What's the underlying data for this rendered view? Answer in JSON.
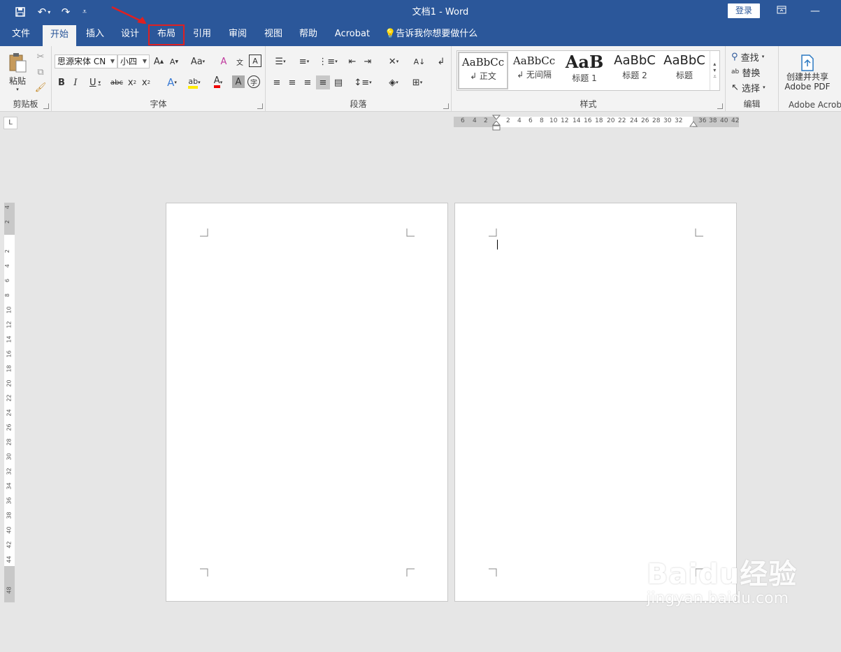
{
  "titlebar": {
    "title": "文档1  -  Word",
    "login_label": "登录",
    "quick_access": [
      "save-icon",
      "undo-icon",
      "redo-icon",
      "customize-icon"
    ]
  },
  "tabs": [
    {
      "label": "文件"
    },
    {
      "label": "开始"
    },
    {
      "label": "插入"
    },
    {
      "label": "设计"
    },
    {
      "label": "布局"
    },
    {
      "label": "引用"
    },
    {
      "label": "审阅"
    },
    {
      "label": "视图"
    },
    {
      "label": "帮助"
    },
    {
      "label": "Acrobat"
    }
  ],
  "tell_me": "告诉我你想要做什么",
  "clipboard": {
    "paste_label": "粘贴",
    "group_label": "剪贴板"
  },
  "font": {
    "font_name": "思源宋体 CN",
    "font_size": "小四",
    "group_label": "字体"
  },
  "paragraph": {
    "group_label": "段落"
  },
  "styles": {
    "group_label": "样式",
    "items": [
      {
        "preview": "AaBbCc",
        "name": "↲ 正文"
      },
      {
        "preview": "AaBbCc",
        "name": "↲ 无间隔"
      },
      {
        "preview": "AaB",
        "name": "标题 1"
      },
      {
        "preview": "AaBbC",
        "name": "标题 2"
      },
      {
        "preview": "AaBbC",
        "name": "标题"
      }
    ]
  },
  "editing": {
    "find": "查找",
    "replace": "替换",
    "select": "选择",
    "group_label": "编辑"
  },
  "acrobat": {
    "create_line1": "创建并共享",
    "create_line2": "Adobe PDF",
    "group_label": "Adobe Acrob"
  },
  "ruler": {
    "h_left": [
      "6",
      "4",
      "2"
    ],
    "h_main": [
      "2",
      "4",
      "6",
      "8",
      "10",
      "12",
      "14",
      "16",
      "18",
      "20",
      "22",
      "24",
      "26",
      "28",
      "30",
      "32"
    ],
    "h_right": [
      "36",
      "38",
      "40",
      "42"
    ],
    "v_top": [
      "4",
      "2"
    ],
    "v_main": [
      "2",
      "4",
      "6",
      "8",
      "10",
      "12",
      "14",
      "16",
      "18",
      "20",
      "22",
      "24",
      "26",
      "28",
      "30",
      "32",
      "34",
      "36",
      "38",
      "40",
      "42",
      "44"
    ],
    "v_bottom": [
      "48"
    ]
  },
  "watermark": {
    "line1": "Baidu经验",
    "line2": "jingyan.baidu.com"
  },
  "colors": {
    "accent": "#2b579a",
    "highlight_box": "#e02020"
  }
}
